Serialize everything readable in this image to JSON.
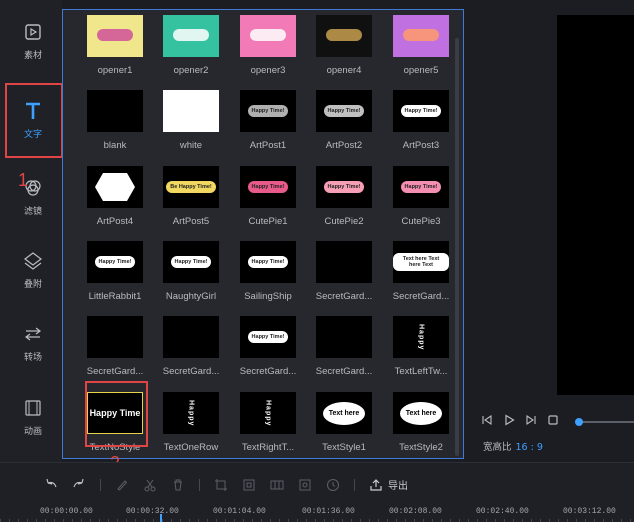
{
  "sidebar": {
    "items": [
      {
        "label": "素材",
        "icon": "media-icon"
      },
      {
        "label": "文字",
        "icon": "text-icon",
        "active": true
      },
      {
        "label": "滤镜",
        "icon": "filter-icon"
      },
      {
        "label": "叠附",
        "icon": "overlay-icon"
      },
      {
        "label": "转场",
        "icon": "transition-icon"
      },
      {
        "label": "动画",
        "icon": "animation-icon"
      }
    ]
  },
  "annotations": {
    "one": "1",
    "two": "2",
    "color": "#e04545"
  },
  "templates": [
    {
      "name": "opener1",
      "bg": "#f0e68c",
      "accent": "#d0509a"
    },
    {
      "name": "opener2",
      "bg": "#35c2a0",
      "accent": "#ffffff"
    },
    {
      "name": "opener3",
      "bg": "#f27ab6",
      "accent": "#ffffff"
    },
    {
      "name": "opener4",
      "bg": "#101010",
      "accent": "#c8a050"
    },
    {
      "name": "opener5",
      "bg": "#c070e0",
      "accent": "#ff9b6a"
    },
    {
      "name": "blank",
      "bg": "#000000",
      "accent": "#000000"
    },
    {
      "name": "white",
      "bg": "#ffffff",
      "accent": "#ffffff"
    },
    {
      "name": "ArtPost1",
      "bg": "#000000",
      "accent": "#b0b0b0",
      "text": "Happy Time!"
    },
    {
      "name": "ArtPost2",
      "bg": "#000000",
      "accent": "#c0c0c0",
      "text": "Happy Time!"
    },
    {
      "name": "ArtPost3",
      "bg": "#000000",
      "accent": "#ffffff",
      "text": "Happy Time!"
    },
    {
      "name": "ArtPost4",
      "bg": "#000000",
      "accent": "#ffffff"
    },
    {
      "name": "ArtPost5",
      "bg": "#000000",
      "accent": "#f2d860",
      "text": "Be Happy Time!"
    },
    {
      "name": "CutePie1",
      "bg": "#000000",
      "accent": "#e85a8a",
      "text": "Happy Time!"
    },
    {
      "name": "CutePie2",
      "bg": "#000000",
      "accent": "#f7a0b5",
      "text": "Happy Time!"
    },
    {
      "name": "CutePie3",
      "bg": "#000000",
      "accent": "#f48fb1",
      "text": "Happy Time!"
    },
    {
      "name": "LittleRabbit1",
      "bg": "#000000",
      "accent": "#ffffff",
      "text": "Happy Time!"
    },
    {
      "name": "NaughtyGirl",
      "bg": "#000000",
      "accent": "#ffffff",
      "text": "Happy Time!"
    },
    {
      "name": "SailingShip",
      "bg": "#000000",
      "accent": "#ffffff",
      "text": "Happy Time!"
    },
    {
      "name": "SecretGard...",
      "bg": "#000000",
      "accent": "#ffffff"
    },
    {
      "name": "SecretGard...",
      "bg": "#000000",
      "accent": "#ffffff",
      "text": "Text here Text here Text"
    },
    {
      "name": "SecretGard...",
      "bg": "#000000",
      "accent": "#ffffff"
    },
    {
      "name": "SecretGard...",
      "bg": "#000000",
      "accent": "#ffffff"
    },
    {
      "name": "SecretGard...",
      "bg": "#000000",
      "accent": "#ffffff",
      "text": "Happy Time!"
    },
    {
      "name": "SecretGard...",
      "bg": "#000000",
      "accent": "#ffffff"
    },
    {
      "name": "TextLeftTw...",
      "bg": "#000000",
      "accent": "#ffffff",
      "text": "Happy"
    },
    {
      "name": "TextNoStyle",
      "bg": "#000000",
      "accent": "#ffffff",
      "text": "Happy Time"
    },
    {
      "name": "TextOneRow",
      "bg": "#000000",
      "accent": "#ffffff",
      "text": "Happy"
    },
    {
      "name": "TextRightT...",
      "bg": "#000000",
      "accent": "#ffffff",
      "text": "Happy"
    },
    {
      "name": "TextStyle1",
      "bg": "#000000",
      "accent": "#ffffff",
      "text": "Text here"
    },
    {
      "name": "TextStyle2",
      "bg": "#000000",
      "accent": "#ffffff",
      "text": "Text here"
    }
  ],
  "preview": {
    "ratio_label": "宽高比",
    "ratio_value": "16 : 9",
    "progress": 0
  },
  "toolbar": {
    "export_label": "导出"
  },
  "timeline": {
    "ticks": [
      "00:00:00.00",
      "00:00:32.00",
      "00:01:04.00",
      "00:01:36.00",
      "00:02:08.00",
      "00:02:40.00",
      "00:03:12.00"
    ]
  },
  "colors": {
    "accent": "#3ea0ff",
    "panel_border": "#3e7ad6",
    "highlight": "#e04545"
  }
}
